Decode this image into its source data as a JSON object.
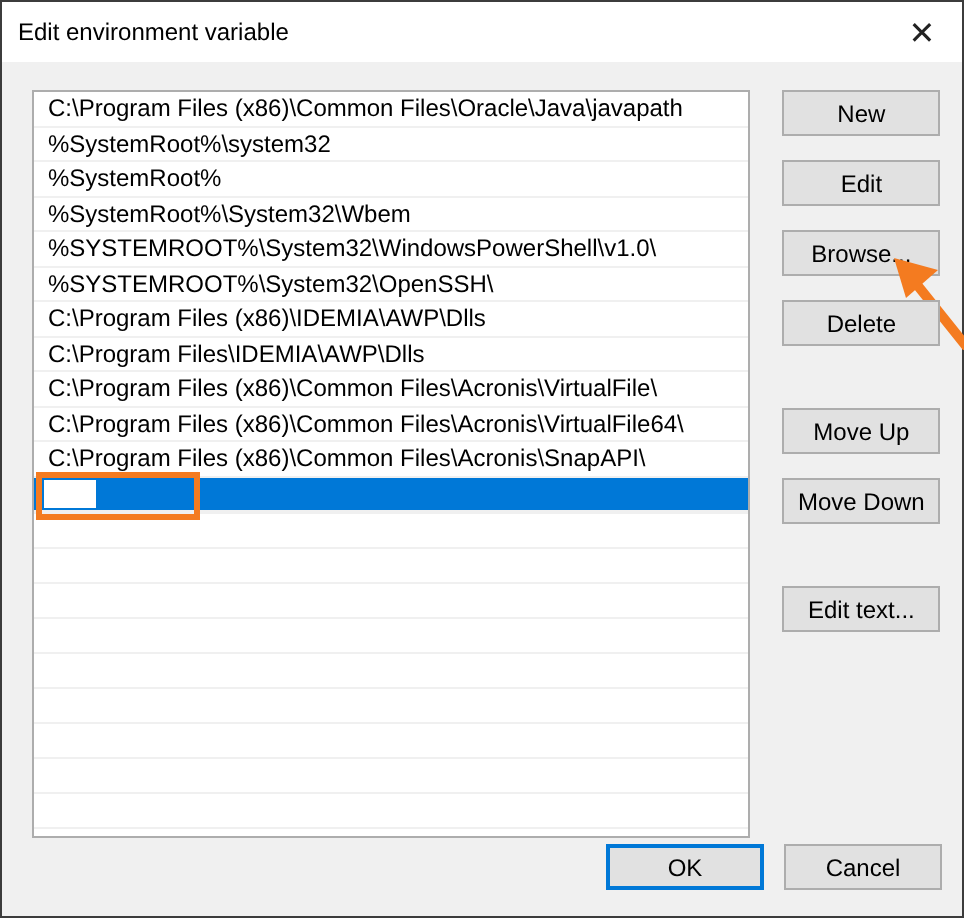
{
  "window": {
    "title": "Edit environment variable",
    "close": "✕"
  },
  "paths": [
    {
      "kind": "text",
      "text": "C:\\Program Files (x86)\\Common Files\\Oracle\\Java\\javapath",
      "selected": false
    },
    {
      "kind": "text",
      "text": "%SystemRoot%\\system32",
      "selected": false
    },
    {
      "kind": "text",
      "text": "%SystemRoot%",
      "selected": false
    },
    {
      "kind": "text",
      "text": "%SystemRoot%\\System32\\Wbem",
      "selected": false
    },
    {
      "kind": "text",
      "text": "%SYSTEMROOT%\\System32\\WindowsPowerShell\\v1.0\\",
      "selected": false
    },
    {
      "kind": "text",
      "text": "%SYSTEMROOT%\\System32\\OpenSSH\\",
      "selected": false
    },
    {
      "kind": "text",
      "text": "C:\\Program Files (x86)\\IDEMIA\\AWP\\Dlls",
      "selected": false
    },
    {
      "kind": "text",
      "text": "C:\\Program Files\\IDEMIA\\AWP\\Dlls",
      "selected": false
    },
    {
      "kind": "text",
      "text": "C:\\Program Files (x86)\\Common Files\\Acronis\\VirtualFile\\",
      "selected": false
    },
    {
      "kind": "text",
      "text": "C:\\Program Files (x86)\\Common Files\\Acronis\\VirtualFile64\\",
      "selected": false
    },
    {
      "kind": "text",
      "text": "C:\\Program Files (x86)\\Common Files\\Acronis\\SnapAPI\\",
      "selected": false
    },
    {
      "kind": "editing",
      "selected": true,
      "highlighted": true
    }
  ],
  "side_button_groups": [
    {
      "buttons": [
        {
          "label": "New"
        },
        {
          "label": "Edit"
        },
        {
          "label": "Browse...",
          "pointed": true
        },
        {
          "label": "Delete"
        }
      ]
    },
    {
      "buttons": [
        {
          "label": "Move Up"
        },
        {
          "label": "Move Down"
        }
      ]
    },
    {
      "buttons": [
        {
          "label": "Edit text..."
        }
      ]
    }
  ],
  "footer_buttons": [
    {
      "label": "OK",
      "default": true
    },
    {
      "label": "Cancel",
      "default": false
    }
  ]
}
